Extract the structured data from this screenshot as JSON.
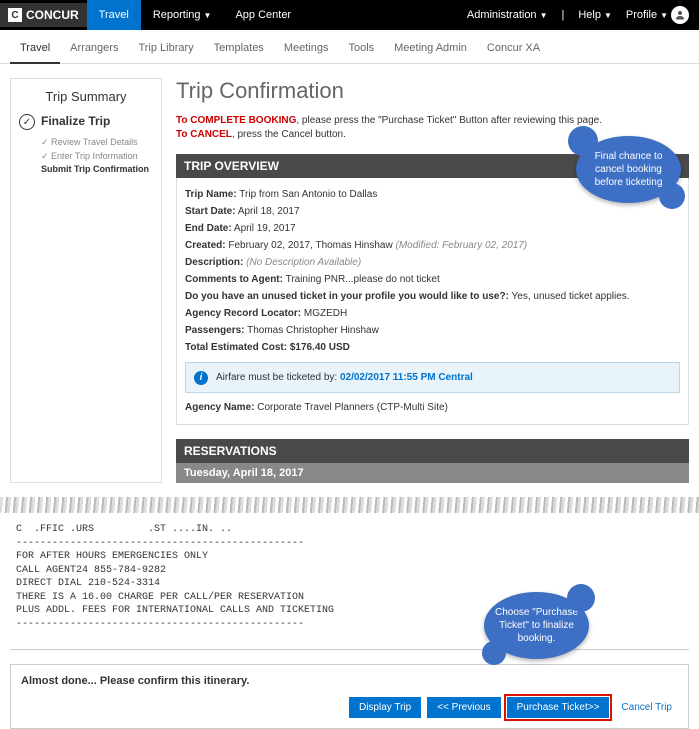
{
  "brand": "CONCUR",
  "mainnav": [
    "Travel",
    "Reporting",
    "App Center"
  ],
  "topright": {
    "admin": "Administration",
    "help": "Help",
    "profile": "Profile"
  },
  "subnav": [
    "Travel",
    "Arrangers",
    "Trip Library",
    "Templates",
    "Meetings",
    "Tools",
    "Meeting Admin",
    "Concur XA"
  ],
  "sidebar": {
    "title": "Trip Summary",
    "finalize": "Finalize Trip",
    "items": [
      "Review Travel Details",
      "Enter Trip Information",
      "Submit Trip Confirmation"
    ]
  },
  "page_title": "Trip Confirmation",
  "instructions": {
    "complete_prefix": "To COMPLETE BOOKING",
    "complete_rest": ", please press the \"Purchase Ticket\" Button after reviewing this page.",
    "cancel_prefix": "To CANCEL",
    "cancel_rest": ", press the Cancel button."
  },
  "overview_header": "TRIP OVERVIEW",
  "overview": {
    "trip_name_label": "Trip Name:",
    "trip_name": "Trip from San Antonio to Dallas",
    "start_label": "Start Date:",
    "start": "April 18, 2017",
    "end_label": "End Date:",
    "end": "April 19, 2017",
    "created_label": "Created:",
    "created": "February 02, 2017, Thomas Hinshaw",
    "modified": "(Modified: February 02, 2017)",
    "desc_label": "Description:",
    "desc": "(No Description Available)",
    "comments_label": "Comments to Agent:",
    "comments": "Training PNR...please do not ticket",
    "unused_label": "Do you have an unused ticket in your profile you would like to use?:",
    "unused": "Yes, unused ticket applies.",
    "locator_label": "Agency Record Locator:",
    "locator": "MGZEDH",
    "pax_label": "Passengers:",
    "pax": "Thomas Christopher Hinshaw",
    "cost_label": "Total Estimated Cost:",
    "cost": "$176.40 USD",
    "info_text": "Airfare must be ticketed by:",
    "info_date": "02/02/2017 11:55 PM Central",
    "agency_label": "Agency Name:",
    "agency": "Corporate Travel Planners (CTP-Multi Site)"
  },
  "reservations_header": "RESERVATIONS",
  "res_date": "Tuesday, April 18, 2017",
  "ticket_text": "C  .FFIC .URS         .ST ....IN. ..\n------------------------------------------------\nFOR AFTER HOURS EMERGENCIES ONLY\nCALL AGENT24 855-784-9282\nDIRECT DIAL 210-524-3314\nTHERE IS A 16.00 CHARGE PER CALL/PER RESERVATION\nPLUS ADDL. FEES FOR INTERNATIONAL CALLS AND TICKETING\n------------------------------------------------",
  "confirm_msg": "Almost done... Please confirm this itinerary.",
  "buttons": {
    "display": "Display Trip",
    "prev": "<< Previous",
    "purchase": "Purchase Ticket>>",
    "cancel": "Cancel Trip"
  },
  "callouts": {
    "c1": "Final chance to cancel booking before ticketing",
    "c2": "Choose \"Purchase Ticket\" to finalize booking."
  }
}
